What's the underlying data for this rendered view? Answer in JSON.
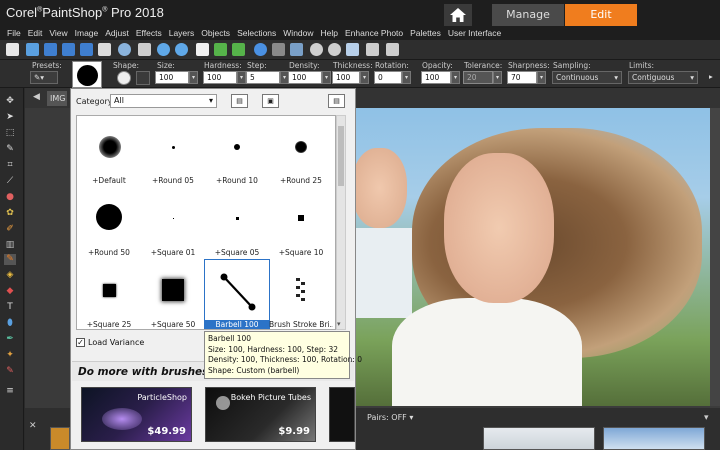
{
  "app": {
    "title_brand": "Corel",
    "title_product": "PaintShop",
    "title_rest": "Pro 2018"
  },
  "workspace_tabs": {
    "manage": "Manage",
    "edit": "Edit"
  },
  "menu": [
    "File",
    "Edit",
    "View",
    "Image",
    "Adjust",
    "Effects",
    "Layers",
    "Objects",
    "Selections",
    "Window",
    "Help",
    "Enhance Photo",
    "Palettes",
    "User Interface"
  ],
  "options": {
    "presets_label": "Presets:",
    "shape_label": "Shape:",
    "size_label": "Size:",
    "size_value": "100",
    "hardness_label": "Hardness:",
    "hardness_value": "100",
    "step_label": "Step:",
    "step_value": "5",
    "density_label": "Density:",
    "density_value": "100",
    "thickness_label": "Thickness:",
    "thickness_value": "100",
    "rotation_label": "Rotation:",
    "rotation_value": "0",
    "opacity_label": "Opacity:",
    "opacity_value": "100",
    "tolerance_label": "Tolerance:",
    "tolerance_value": "20",
    "sharpness_label": "Sharpness:",
    "sharpness_value": "70",
    "sampling_label": "Sampling:",
    "sampling_value": "Continuous",
    "limits_label": "Limits:",
    "limits_value": "Contiguous"
  },
  "subbar": {
    "tab_label": "IMG"
  },
  "brush_panel": {
    "category_label": "Category:",
    "category_value": "All",
    "brushes": [
      {
        "label": "+Default"
      },
      {
        "label": "+Round 05"
      },
      {
        "label": "+Round 10"
      },
      {
        "label": "+Round 25"
      },
      {
        "label": "+Round 50"
      },
      {
        "label": "+Square 01"
      },
      {
        "label": "+Square 05"
      },
      {
        "label": "+Square 10"
      },
      {
        "label": "+Square 25"
      },
      {
        "label": "+Square 50"
      },
      {
        "label": "Barbell 100"
      },
      {
        "label": "Brush Stroke Bri..."
      }
    ],
    "load_variance_label": "Load Variance",
    "promo_header": "Do more with brushes!",
    "promos": [
      {
        "title": "ParticleShop",
        "price": "$49.99"
      },
      {
        "title": "Bokeh Picture Tubes",
        "price": "$9.99"
      }
    ]
  },
  "tooltip": {
    "line1": "Barbell 100",
    "line2": "Size: 100, Hardness: 100, Step: 32",
    "line3": "Density: 100, Thickness: 100, Rotation: 0",
    "line4": "Shape: Custom (barbell)"
  },
  "bottom": {
    "pairs_label": "Pairs: OFF"
  },
  "colors": {
    "accent": "#f07d1e",
    "selection": "#2c73c7",
    "tooltip_bg": "#ffffe1"
  }
}
